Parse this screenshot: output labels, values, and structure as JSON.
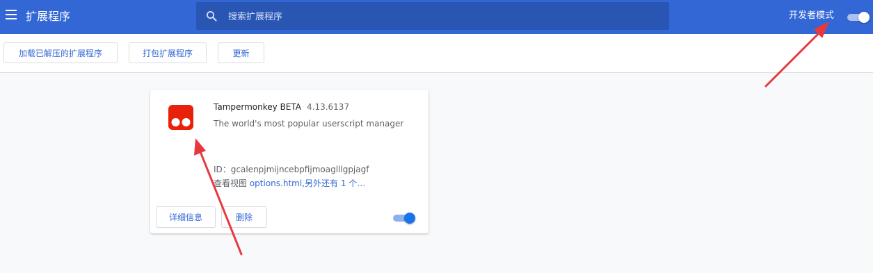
{
  "header": {
    "title": "扩展程序",
    "search_placeholder": "搜索扩展程序",
    "dev_mode_label": "开发者模式",
    "dev_mode_enabled": true
  },
  "toolbar": {
    "load_unpacked": "加载已解压的扩展程序",
    "pack": "打包扩展程序",
    "update": "更新"
  },
  "extension": {
    "name": "Tampermonkey BETA",
    "version": "4.13.6137",
    "description": "The world's most popular userscript manager",
    "id_text": "ID：gcalenpjmijncebpfijmoaglllgpjagf",
    "views_prefix": "查看视图 ",
    "views_link": "options.html",
    "views_more": ",另外还有 1 个…",
    "details_button": "详细信息",
    "remove_button": "删除",
    "enabled": true
  },
  "colors": {
    "header": "#3367d6",
    "search_bg": "#2a56b3",
    "accent": "#3367d6",
    "toggle_on": "#1a73e8",
    "annotation_arrow": "#e8383d",
    "tampermonkey_icon": "#e8210a"
  },
  "annotations": [
    {
      "type": "arrow",
      "target": "dev-mode-toggle"
    },
    {
      "type": "arrow",
      "target": "extension-icon"
    }
  ]
}
